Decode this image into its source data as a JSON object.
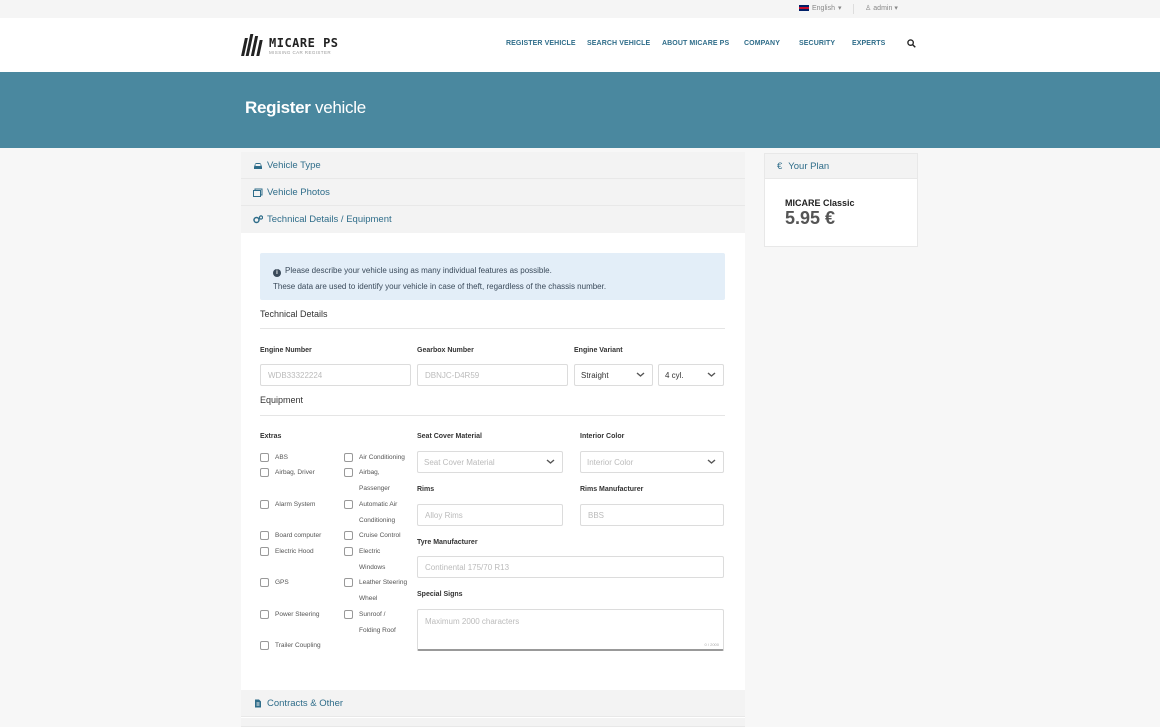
{
  "topbar": {
    "language": "English",
    "user": "admin"
  },
  "logo": {
    "name": "MICARE PS",
    "tagline": "MISSING CAR REGISTER"
  },
  "nav": [
    "REGISTER VEHICLE",
    "SEARCH VEHICLE",
    "ABOUT MICARE PS",
    "COMPANY",
    "SECURITY",
    "EXPERTS"
  ],
  "hero": {
    "title_bold": "Register",
    "title_rest": " vehicle"
  },
  "sections": {
    "vehicle_type": "Vehicle Type",
    "vehicle_photos": "Vehicle Photos",
    "technical": "Technical Details / Equipment",
    "contracts": "Contracts & Other"
  },
  "info": {
    "line1": "Please describe your vehicle using as many individual features as possible.",
    "line2": "These data are used to identify your vehicle in case of theft, regardless of the chassis number."
  },
  "technical_details": {
    "title": "Technical Details",
    "engine_number_label": "Engine Number",
    "engine_number_placeholder": "WDB33322224",
    "gearbox_label": "Gearbox Number",
    "gearbox_placeholder": "DBNJC-D4R59",
    "engine_variant_label": "Engine Variant",
    "engine_variant_value": "Straight",
    "cylinders_value": "4 cyl."
  },
  "equipment": {
    "title": "Equipment",
    "extras_label": "Extras",
    "extras_col1": [
      [
        "ABS"
      ],
      [
        "Airbag, Driver"
      ],
      [
        "Alarm System"
      ],
      [
        "Board computer"
      ],
      [
        "Electric Hood"
      ],
      [
        "GPS"
      ],
      [
        "Power Steering"
      ],
      [
        "Trailer Coupling"
      ]
    ],
    "extras_col2": [
      [
        "Air Conditioning"
      ],
      [
        "Airbag,",
        "Passenger"
      ],
      [
        "Automatic Air",
        "Conditioning"
      ],
      [
        "Cruise Control"
      ],
      [
        "Electric",
        "Windows"
      ],
      [
        "Leather Steering",
        "Wheel"
      ],
      [
        "Sunroof /",
        "Folding Roof"
      ]
    ],
    "seat_cover_label": "Seat Cover Material",
    "seat_cover_placeholder": "Seat Cover Material",
    "interior_color_label": "Interior Color",
    "interior_color_placeholder": "Interior Color",
    "rims_label": "Rims",
    "rims_placeholder": "Alloy Rims",
    "rims_manufacturer_label": "Rims Manufacturer",
    "rims_manufacturer_placeholder": "BBS",
    "tyre_label": "Tyre Manufacturer",
    "tyre_placeholder": "Continental 175/70 R13",
    "special_signs_label": "Special Signs",
    "special_signs_placeholder": "Maximum 2000 characters",
    "special_signs_counter": "0 / 2000"
  },
  "plan": {
    "title": "Your Plan",
    "currency_symbol": "€",
    "name": "MICARE Classic",
    "price": "5.95 €"
  },
  "colors": {
    "primary": "#4a889f",
    "link": "#2f6d8a",
    "info_bg": "#e3eef8"
  }
}
